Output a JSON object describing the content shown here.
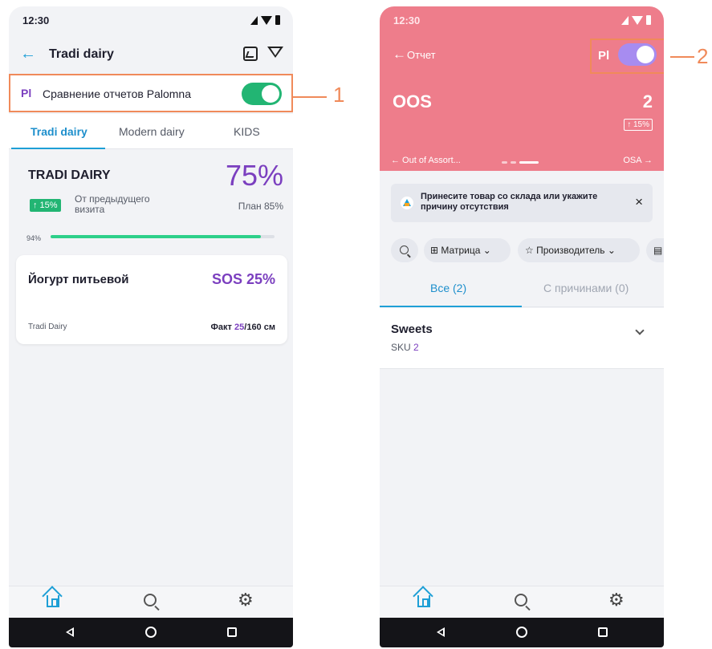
{
  "left_screen": {
    "status": {
      "time": "12:30"
    },
    "header": {
      "title": "Tradi dairy"
    },
    "compare": {
      "mark": "Pl",
      "label": "Сравнение отчетов Palomna",
      "enabled": true
    },
    "tabs": [
      "Tradi dairy",
      "Modern dairy",
      "KIDS"
    ],
    "summary": {
      "category": "TRADI DAIRY",
      "percent": "75%",
      "change_badge": "↑ 15%",
      "change_label": "От предыдущего визита",
      "plan": "План 85%",
      "progress_label": "94%",
      "progress_value": 0.94
    },
    "card": {
      "product": "Йогурт питьевой",
      "metric": "SOS 25%",
      "brand": "Tradi Dairy",
      "fact_label": "Факт",
      "fact_value": "25",
      "fact_total": "/160 см"
    }
  },
  "right_screen": {
    "status": {
      "time": "12:30"
    },
    "header": {
      "back_label": "Отчет",
      "mark": "Pl",
      "enabled": true
    },
    "metric": {
      "name": "OOS",
      "value": "2",
      "change_badge": "↑ 15%"
    },
    "carousel": {
      "prev": "← Out of Assort...",
      "next": "OSA →"
    },
    "tip": {
      "text": "Принесите товар со склада или укажите причину отсутствия",
      "close": "×"
    },
    "filters": {
      "matrix": "Матрица",
      "maker": "Производитель"
    },
    "tabs": [
      "Все (2)",
      "С причинами (0)"
    ],
    "group": {
      "title": "Sweets",
      "sku_label": "SKU",
      "sku_count": "2"
    }
  },
  "callouts": [
    "1",
    "2"
  ],
  "colors": {
    "accent_blue": "#1e9fd6",
    "purple": "#7b3fbf",
    "green": "#22b573",
    "hero_pink": "#ee7d8b",
    "callout": "#f08a5a"
  }
}
